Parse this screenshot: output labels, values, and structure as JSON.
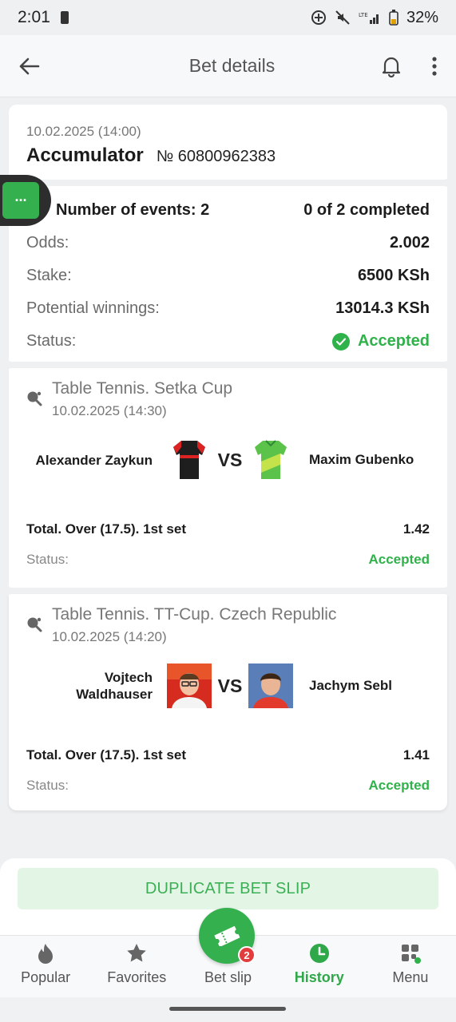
{
  "status_bar": {
    "time": "2:01",
    "battery": "32%"
  },
  "appbar": {
    "title": "Bet details"
  },
  "bet": {
    "date": "10.02.2025 (14:00)",
    "type": "Accumulator",
    "number": "№ 60800962383",
    "events_label": "Number of events: 2",
    "completed": "0 of 2 completed",
    "odds_label": "Odds:",
    "odds": "2.002",
    "stake_label": "Stake:",
    "stake": "6500 KSh",
    "winnings_label": "Potential winnings:",
    "winnings": "13014.3 KSh",
    "status_label": "Status:",
    "status": "Accepted"
  },
  "events": [
    {
      "league": "Table Tennis. Setka Cup",
      "date": "10.02.2025 (14:30)",
      "team1": "Alexander Zaykun",
      "team2": "Maxim Gubenko",
      "vs": "VS",
      "market": "Total. Over (17.5). 1st set",
      "odd": "1.42",
      "status_label": "Status:",
      "status": "Accepted"
    },
    {
      "league": "Table Tennis. TT-Cup. Czech Republic",
      "date": "10.02.2025 (14:20)",
      "team1_line1": "Vojtech",
      "team1_line2": "Waldhauser",
      "team2": "Jachym Sebl",
      "vs": "VS",
      "market": "Total. Over (17.5). 1st set",
      "odd": "1.41",
      "status_label": "Status:",
      "status": "Accepted"
    }
  ],
  "float_tab": {
    "label": "···"
  },
  "actions": {
    "duplicate": "DUPLICATE BET SLIP"
  },
  "tabbar": {
    "popular": "Popular",
    "favorites": "Favorites",
    "betslip": "Bet slip",
    "betslip_count": "2",
    "history": "History",
    "menu": "Menu"
  },
  "colors": {
    "accent": "#35b04f",
    "accepted": "#2fb24a",
    "badge": "#e23c3c"
  }
}
